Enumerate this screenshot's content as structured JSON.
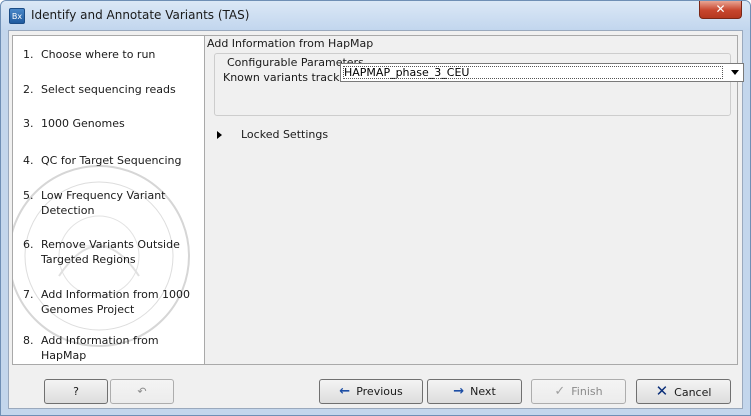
{
  "window": {
    "title": "Identify and Annotate Variants (TAS)",
    "app_icon_text": "Bx",
    "close_glyph": "✕"
  },
  "steps": [
    {
      "num": "1.",
      "label": "Choose where to run"
    },
    {
      "num": "2.",
      "label": "Select sequencing reads"
    },
    {
      "num": "3.",
      "label": "1000 Genomes"
    },
    {
      "num": "4.",
      "label": "QC for Target Sequencing"
    },
    {
      "num": "5.",
      "label": "Low Frequency Variant Detection"
    },
    {
      "num": "6.",
      "label": "Remove Variants Outside Targeted Regions"
    },
    {
      "num": "7.",
      "label": "Add Information from 1000 Genomes Project"
    },
    {
      "num": "8.",
      "label": "Add Information from HapMap"
    }
  ],
  "content": {
    "section_title": "Add Information from HapMap",
    "group_title": "Configurable Parameters",
    "known_variants_label": "Known variants track",
    "known_variants_value": "HAPMAP_phase_3_CEU",
    "locked_settings_label": "Locked Settings"
  },
  "buttons": {
    "help": "?",
    "reset_icon": "↶",
    "previous": "Previous",
    "next": "Next",
    "finish": "Finish",
    "cancel": "Cancel"
  },
  "colors": {
    "accent": "#1e4fa5",
    "close": "#c7452d"
  }
}
